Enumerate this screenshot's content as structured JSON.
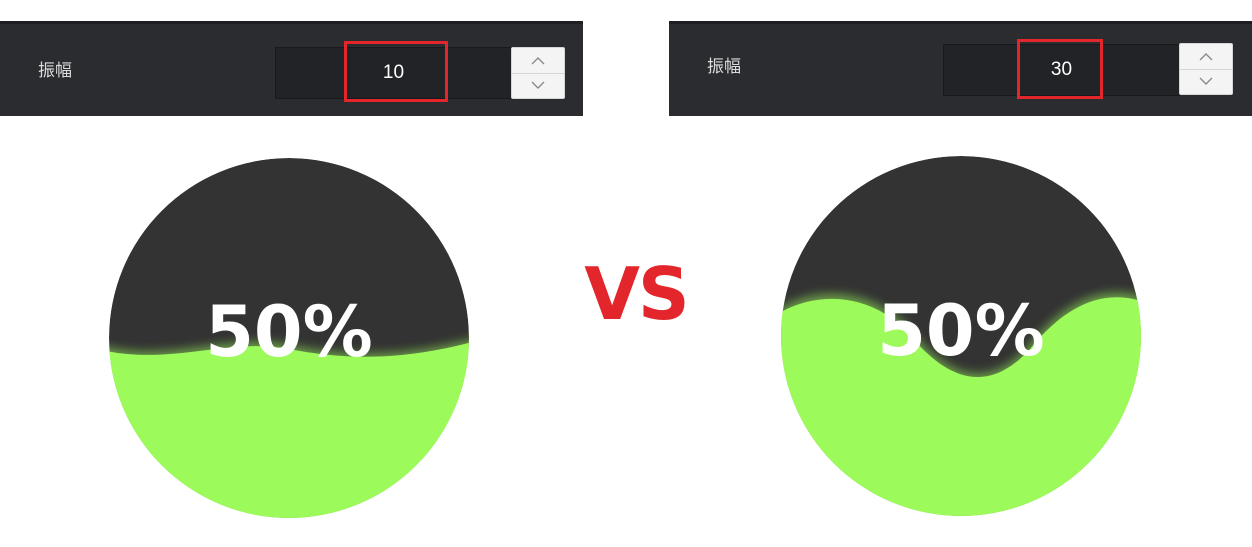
{
  "left_panel": {
    "label": "振幅",
    "amplitude_value": "10"
  },
  "right_panel": {
    "label": "振幅",
    "amplitude_value": "30"
  },
  "left_gauge": {
    "percent_text": "50%",
    "fill_fraction": 0.5
  },
  "right_gauge": {
    "percent_text": "50%",
    "fill_fraction": 0.5
  },
  "vs_text": "VS",
  "colors": {
    "panel_bg": "#2b2c2f",
    "field_bg": "#222326",
    "highlight": "#e3262c",
    "gauge_dark": "#333333",
    "wave_green": "#9dfa5b",
    "vs_red": "#e3262c"
  },
  "icons": {
    "increment": "chevron-up-icon",
    "decrement": "chevron-down-icon"
  }
}
